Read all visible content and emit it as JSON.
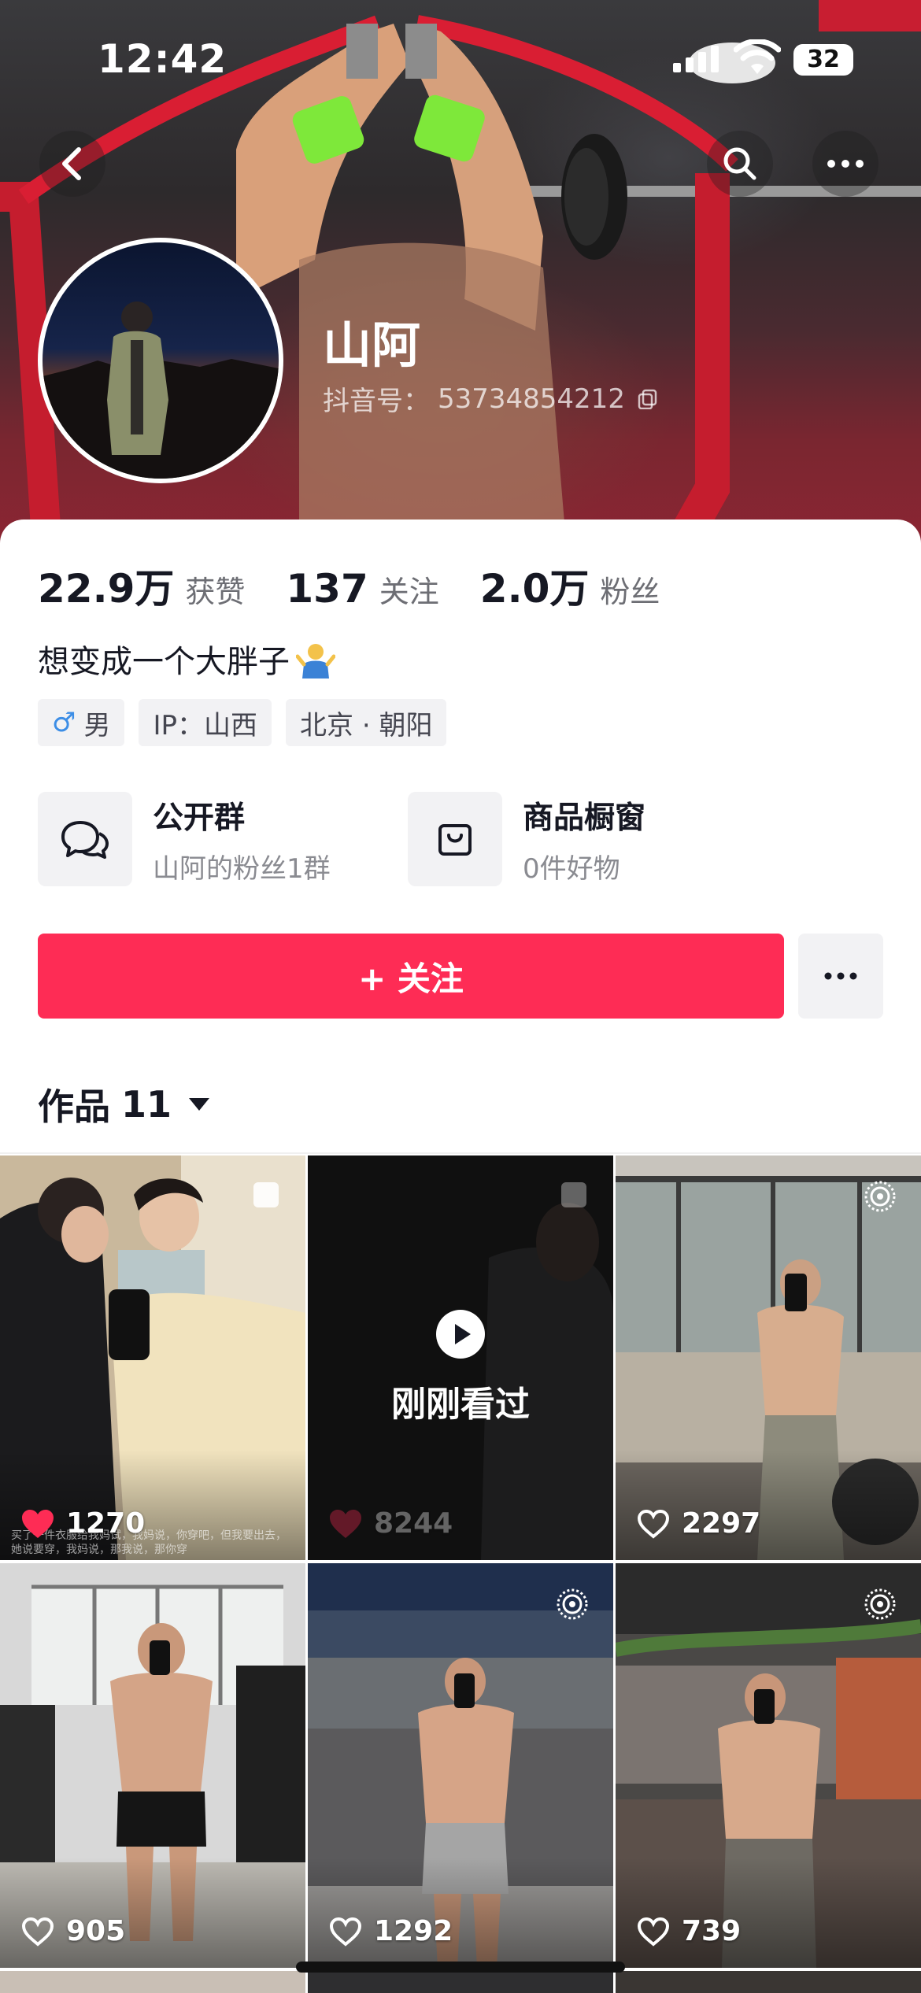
{
  "status_bar": {
    "time": "12:42",
    "battery": "32"
  },
  "profile": {
    "nickname": "山阿",
    "douyin_id_label": "抖音号：",
    "douyin_id": "53734854212"
  },
  "stats": [
    {
      "value": "22.9万",
      "label": "获赞"
    },
    {
      "value": "137",
      "label": "关注"
    },
    {
      "value": "2.0万",
      "label": "粉丝"
    }
  ],
  "bio": "想变成一个大胖子",
  "tags": [
    {
      "icon": "male-icon",
      "symbol": "♂",
      "label": "男"
    },
    {
      "label": "IP：山西"
    },
    {
      "label": "北京 · 朝阳"
    }
  ],
  "features": {
    "group": {
      "title": "公开群",
      "subtitle": "山阿的粉丝1群",
      "icon": "chat-bubbles-icon"
    },
    "shop": {
      "title": "商品橱窗",
      "subtitle": "0件好物",
      "icon": "shopping-bag-icon"
    }
  },
  "actions": {
    "follow_label": "+ 关注",
    "more_icon": "more-dots-icon"
  },
  "works": {
    "label": "作品",
    "count": "11"
  },
  "videos": [
    {
      "likes": "1270",
      "liked": true,
      "badge": "image-album-icon",
      "caption": "买了一件衣服给我妈试，我妈说，你穿吧，但我要出去，她说要穿，我妈说，那我说，那你穿"
    },
    {
      "likes": "8244",
      "liked": true,
      "badge": "image-album-icon",
      "watched_label": "刚刚看过"
    },
    {
      "likes": "2297",
      "liked": false,
      "badge": "live-photo-icon"
    },
    {
      "likes": "905",
      "liked": false
    },
    {
      "likes": "1292",
      "liked": false,
      "badge": "live-photo-icon"
    },
    {
      "likes": "739",
      "liked": false,
      "badge": "live-photo-icon"
    }
  ],
  "colors": {
    "accent": "#fe2c55",
    "text": "#161823",
    "muted": "#8a8b91"
  }
}
